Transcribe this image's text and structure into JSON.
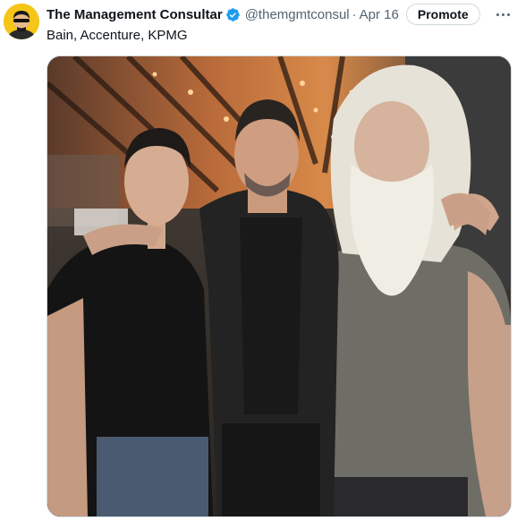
{
  "tweet": {
    "author": {
      "display_name": "The Management Consultar",
      "handle": "@themgmtconsul",
      "verified": true,
      "avatar_icon": "masked-face-avatar-icon"
    },
    "separator": "·",
    "date": "Apr 16",
    "promote_label": "Promote",
    "more_icon": "more-horizontal-icon",
    "text": "Bain, Accenture, KPMG",
    "media": {
      "type": "photo",
      "alt": "Three men posing together in a restaurant under a copper-paneled ceiling"
    }
  },
  "colors": {
    "verified_blue": "#1d9bf0",
    "secondary_text": "#536471",
    "primary_text": "#0f1419",
    "border": "#cfd9de"
  }
}
